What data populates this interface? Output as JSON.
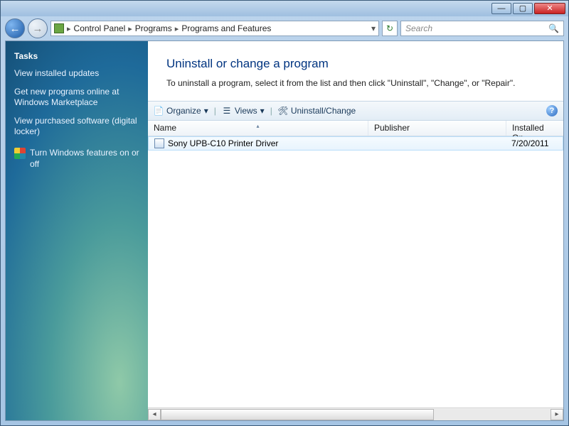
{
  "window": {
    "min": "—",
    "max": "▢",
    "close": "✕"
  },
  "breadcrumb": [
    "Control Panel",
    "Programs",
    "Programs and Features"
  ],
  "search": {
    "placeholder": "Search"
  },
  "sidebar": {
    "tasks_header": "Tasks",
    "links": [
      "View installed updates",
      "Get new programs online at Windows Marketplace",
      "View purchased software (digital locker)"
    ],
    "feature_link": "Turn Windows features on or off"
  },
  "main": {
    "heading": "Uninstall or change a program",
    "subtext": "To uninstall a program, select it from the list and then click \"Uninstall\", \"Change\", or \"Repair\"."
  },
  "toolbar": {
    "organize": "Organize",
    "views": "Views",
    "uninstall": "Uninstall/Change"
  },
  "columns": {
    "name": "Name",
    "publisher": "Publisher",
    "installed": "Installed On"
  },
  "items": [
    {
      "name": "Sony UPB-C10 Printer Driver",
      "publisher": "",
      "installed": "7/20/2011"
    }
  ]
}
